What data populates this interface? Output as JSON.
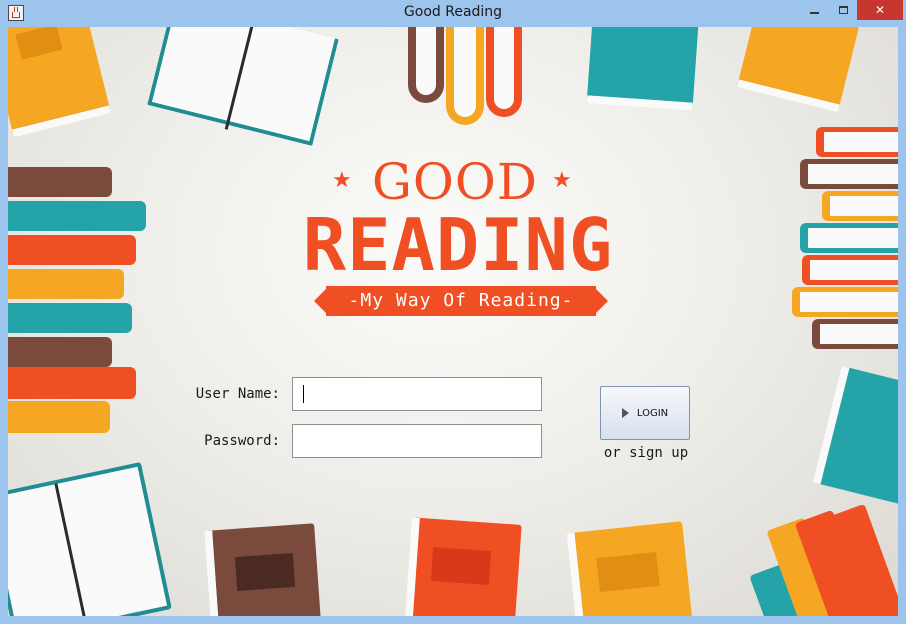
{
  "window": {
    "title": "Good Reading",
    "app_icon": "java-cup-icon",
    "controls": [
      "minimize-icon",
      "maximize-icon",
      "close-icon"
    ],
    "close_glyph": "✕"
  },
  "logo": {
    "line1": "GOOD",
    "line2": "READING",
    "tagline": "-My Way Of Reading-",
    "star": "★",
    "accent_color": "#f04e23"
  },
  "form": {
    "username_label": "User Name:",
    "username_value": "",
    "password_label": "Password:",
    "password_value": "",
    "login_label": "LOGIN",
    "signup_text": "or sign up"
  },
  "palette": {
    "orange": "#f5a623",
    "red": "#f04e23",
    "teal": "#24a4a8",
    "brown": "#7a4a3c",
    "window_frame": "#9cc4ec"
  }
}
